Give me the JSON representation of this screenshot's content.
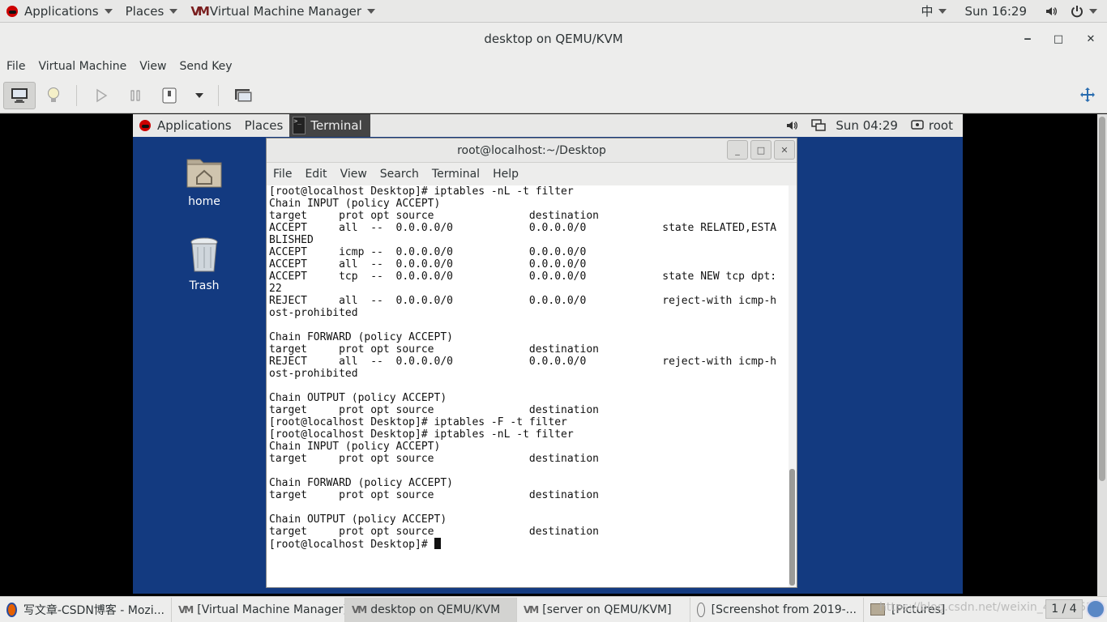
{
  "host_topbar": {
    "applications": "Applications",
    "places": "Places",
    "app_menu": "Virtual Machine Manager",
    "input_method": "中",
    "clock": "Sun 16:29"
  },
  "window": {
    "title": "desktop on QEMU/KVM",
    "minimize": "‒",
    "maximize": "□",
    "close": "✕"
  },
  "menubar": {
    "file": "File",
    "virtual_machine": "Virtual Machine",
    "view": "View",
    "send_key": "Send Key"
  },
  "guest": {
    "topbar": {
      "applications": "Applications",
      "places": "Places",
      "terminal_tab": "Terminal",
      "clock": "Sun 04:29",
      "user": "root"
    },
    "desktop_icons": {
      "home": "home",
      "trash": "Trash"
    },
    "terminal": {
      "title": "root@localhost:~/Desktop",
      "menu": {
        "file": "File",
        "edit": "Edit",
        "view": "View",
        "search": "Search",
        "terminal": "Terminal",
        "help": "Help"
      },
      "lines": [
        "[root@localhost Desktop]# iptables -nL -t filter",
        "Chain INPUT (policy ACCEPT)",
        "target     prot opt source               destination",
        "ACCEPT     all  --  0.0.0.0/0            0.0.0.0/0            state RELATED,ESTA",
        "BLISHED",
        "ACCEPT     icmp --  0.0.0.0/0            0.0.0.0/0",
        "ACCEPT     all  --  0.0.0.0/0            0.0.0.0/0",
        "ACCEPT     tcp  --  0.0.0.0/0            0.0.0.0/0            state NEW tcp dpt:",
        "22",
        "REJECT     all  --  0.0.0.0/0            0.0.0.0/0            reject-with icmp-h",
        "ost-prohibited",
        "",
        "Chain FORWARD (policy ACCEPT)",
        "target     prot opt source               destination",
        "REJECT     all  --  0.0.0.0/0            0.0.0.0/0            reject-with icmp-h",
        "ost-prohibited",
        "",
        "Chain OUTPUT (policy ACCEPT)",
        "target     prot opt source               destination",
        "[root@localhost Desktop]# iptables -F -t filter",
        "[root@localhost Desktop]# iptables -nL -t filter",
        "Chain INPUT (policy ACCEPT)",
        "target     prot opt source               destination",
        "",
        "Chain FORWARD (policy ACCEPT)",
        "target     prot opt source               destination",
        "",
        "Chain OUTPUT (policy ACCEPT)",
        "target     prot opt source               destination"
      ],
      "prompt": "[root@localhost Desktop]# "
    }
  },
  "taskbar": {
    "items": [
      "写文章-CSDN博客 - Mozi...",
      "[Virtual Machine Manager]",
      "desktop on QEMU/KVM",
      "[server on QEMU/KVM]",
      "[Screenshot from 2019-...",
      "[Pictures]"
    ],
    "watermark": "https://blog.csdn.net/weixin_44296524",
    "pager": "1 / 4"
  },
  "colors": {
    "guest_desktop": "#133a80",
    "chrome": "#ededec",
    "redhat": "#cc0000"
  }
}
